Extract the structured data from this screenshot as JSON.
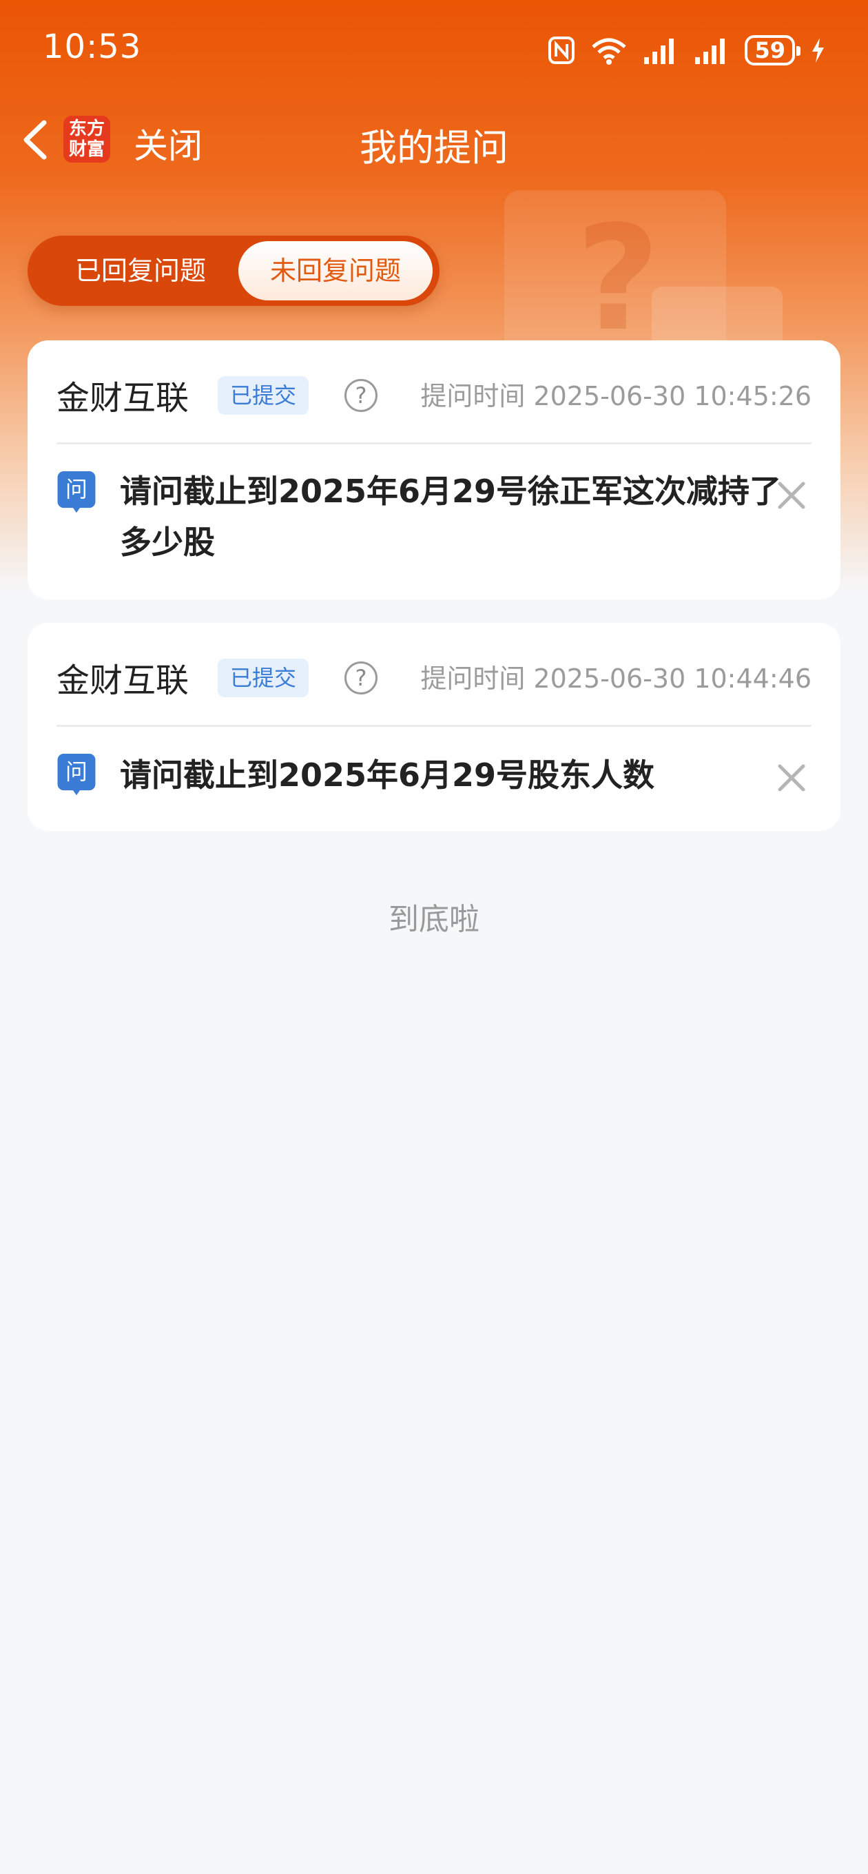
{
  "status_bar": {
    "time": "10:53",
    "battery": "59"
  },
  "nav": {
    "logo_line1": "东方",
    "logo_line2": "财富",
    "close_label": "关闭",
    "title": "我的提问"
  },
  "tabs": [
    {
      "label": "已回复问题",
      "active": false
    },
    {
      "label": "未回复问题",
      "active": true
    }
  ],
  "questions": [
    {
      "company": "金财互联",
      "status": "已提交",
      "help": "?",
      "time": "提问时间 2025-06-30 10:45:26",
      "q_icon_label": "问",
      "text": "请问截止到2025年6月29号徐正军这次减持了多少股"
    },
    {
      "company": "金财互联",
      "status": "已提交",
      "help": "?",
      "time": "提问时间 2025-06-30 10:44:46",
      "q_icon_label": "问",
      "text": "请问截止到2025年6月29号股东人数"
    }
  ],
  "footer": "到底啦",
  "colors": {
    "brand": "#ea5504",
    "badge_bg": "#e6f0fc",
    "badge_text": "#3a7bd5",
    "question_icon": "#3a7bd5"
  }
}
